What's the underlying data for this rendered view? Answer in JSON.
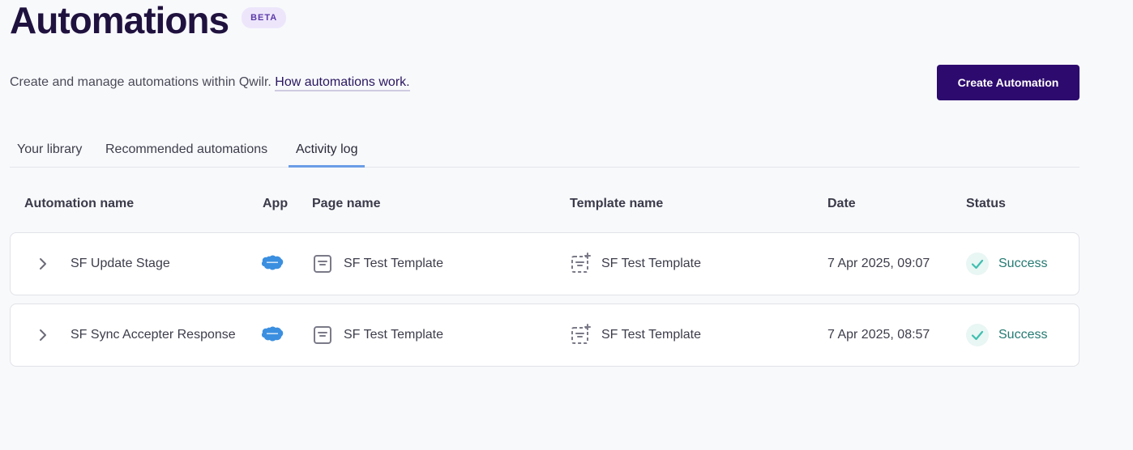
{
  "header": {
    "title": "Automations",
    "badge": "BETA",
    "description": "Create and manage automations within Qwilr.",
    "help_link": "How automations work.",
    "create_button": "Create Automation"
  },
  "tabs": [
    {
      "label": "Your library",
      "active": false
    },
    {
      "label": "Recommended automations",
      "active": false
    },
    {
      "label": "Activity log",
      "active": true
    }
  ],
  "table": {
    "columns": [
      "Automation name",
      "App",
      "Page name",
      "Template name",
      "Date",
      "Status"
    ],
    "rows": [
      {
        "automation_name": "SF Update Stage",
        "app_icon": "salesforce-icon",
        "page_name": "SF Test Template",
        "template_name": "SF Test Template",
        "date": "7 Apr 2025, 09:07",
        "status": "Success"
      },
      {
        "automation_name": "SF Sync Accepter Response",
        "app_icon": "salesforce-icon",
        "page_name": "SF Test Template",
        "template_name": "SF Test Template",
        "date": "7 Apr 2025, 08:57",
        "status": "Success"
      }
    ]
  },
  "colors": {
    "primary_button": "#2d0a6e",
    "active_tab_underline": "#6b9de6",
    "success": "#257a72",
    "salesforce": "#3b8fe0"
  }
}
